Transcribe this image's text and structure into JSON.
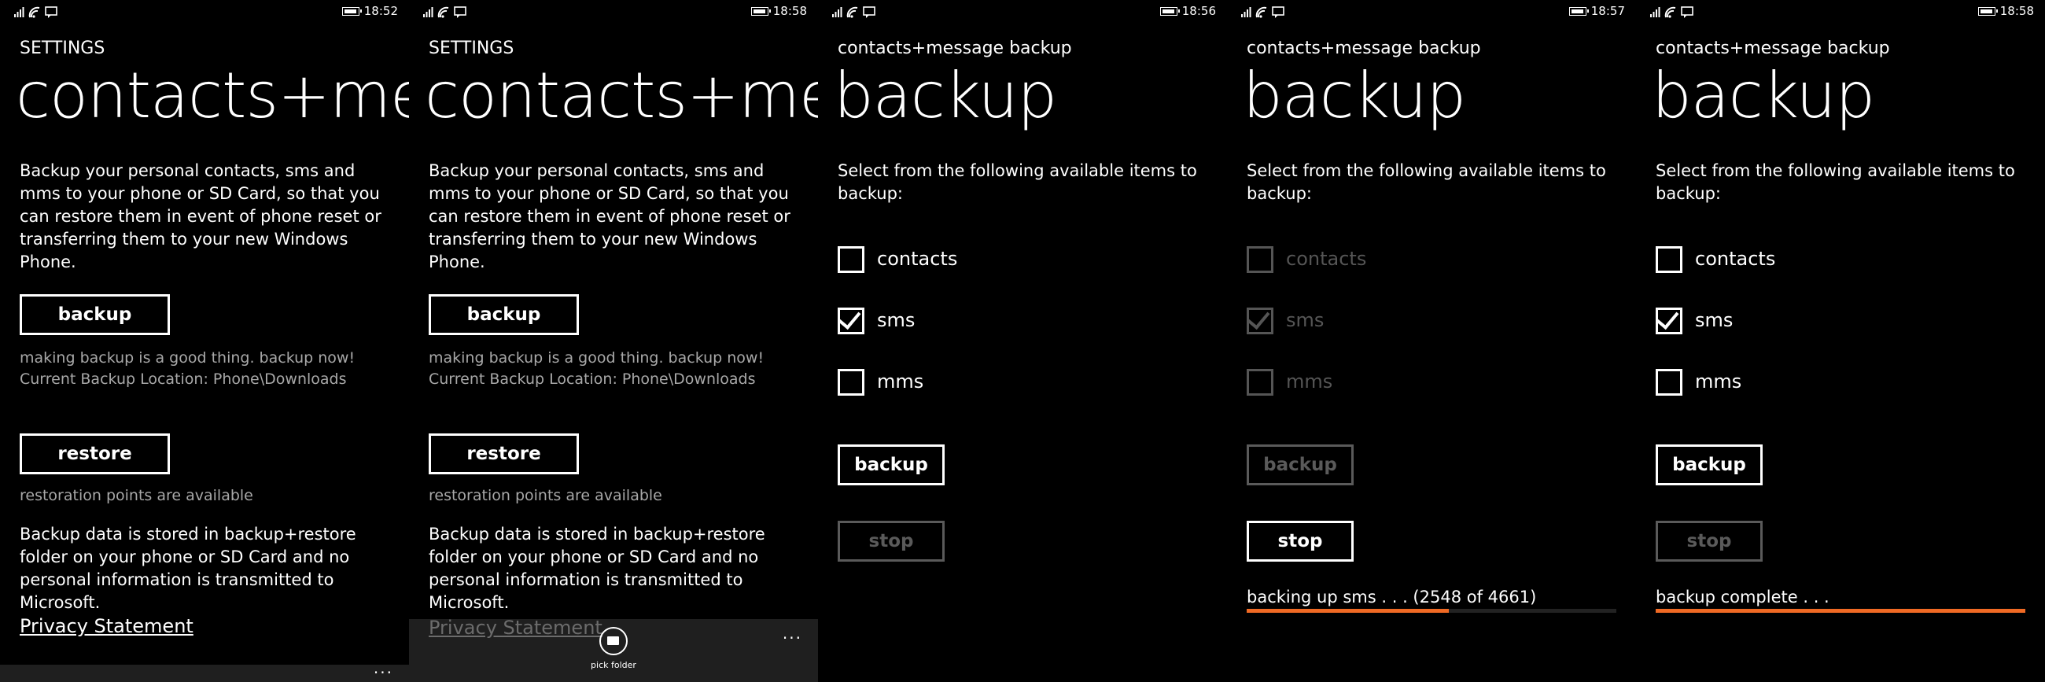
{
  "accent": "#f06a24",
  "screens": [
    {
      "time": "18:52",
      "app_title": "SETTINGS",
      "page_title": "contacts+mess",
      "description": "Backup your personal contacts, sms and mms to your phone or SD Card, so that you can restore them in event of phone reset or transferring them to your new Windows Phone.",
      "backup_label": "backup",
      "backup_hint": "making backup is a good thing. backup now!",
      "backup_location": "Current Backup Location: Phone\\Downloads",
      "restore_label": "restore",
      "restore_hint": "restoration points are available",
      "privacy_note": "Backup data is stored in backup+restore folder on your phone or SD Card and no personal information is transmitted to Microsoft.",
      "privacy_link": "Privacy Statement",
      "more_menu": "..."
    },
    {
      "time": "18:58",
      "app_title": "SETTINGS",
      "page_title": "contacts+mess",
      "description": "Backup your personal contacts, sms and mms to your phone or SD Card, so that you can restore them in event of phone reset or transferring them to your new Windows Phone.",
      "backup_label": "backup",
      "backup_hint": "making backup is a good thing. backup now!",
      "backup_location": "Current Backup Location: Phone\\Downloads",
      "restore_label": "restore",
      "restore_hint": "restoration points are available",
      "privacy_note": "Backup data is stored in backup+restore folder on your phone or SD Card and no personal information is transmitted to Microsoft.",
      "privacy_link": "Privacy Statement",
      "pick_folder_label": "pick folder",
      "more_menu": "..."
    },
    {
      "time": "18:56",
      "app_title": "contacts+message backup",
      "page_title": "backup",
      "instruction": "Select from the following available items to backup:",
      "items": [
        {
          "label": "contacts",
          "checked": false,
          "enabled": true
        },
        {
          "label": "sms",
          "checked": true,
          "enabled": true
        },
        {
          "label": "mms",
          "checked": false,
          "enabled": true
        }
      ],
      "backup_label": "backup",
      "backup_enabled": true,
      "stop_label": "stop",
      "stop_enabled": false
    },
    {
      "time": "18:57",
      "app_title": "contacts+message backup",
      "page_title": "backup",
      "instruction": "Select from the following available items to backup:",
      "items": [
        {
          "label": "contacts",
          "checked": false,
          "enabled": false
        },
        {
          "label": "sms",
          "checked": true,
          "enabled": false
        },
        {
          "label": "mms",
          "checked": false,
          "enabled": false
        }
      ],
      "backup_label": "backup",
      "backup_enabled": false,
      "stop_label": "stop",
      "stop_enabled": true,
      "progress_text": "backing up sms . . . (2548 of 4661)",
      "progress_value": 0.547
    },
    {
      "time": "18:58",
      "app_title": "contacts+message backup",
      "page_title": "backup",
      "instruction": "Select from the following available items to backup:",
      "items": [
        {
          "label": "contacts",
          "checked": false,
          "enabled": true
        },
        {
          "label": "sms",
          "checked": true,
          "enabled": true
        },
        {
          "label": "mms",
          "checked": false,
          "enabled": true
        }
      ],
      "backup_label": "backup",
      "backup_enabled": true,
      "stop_label": "stop",
      "stop_enabled": false,
      "progress_text": "backup complete . . .",
      "progress_value": 1.0
    }
  ]
}
